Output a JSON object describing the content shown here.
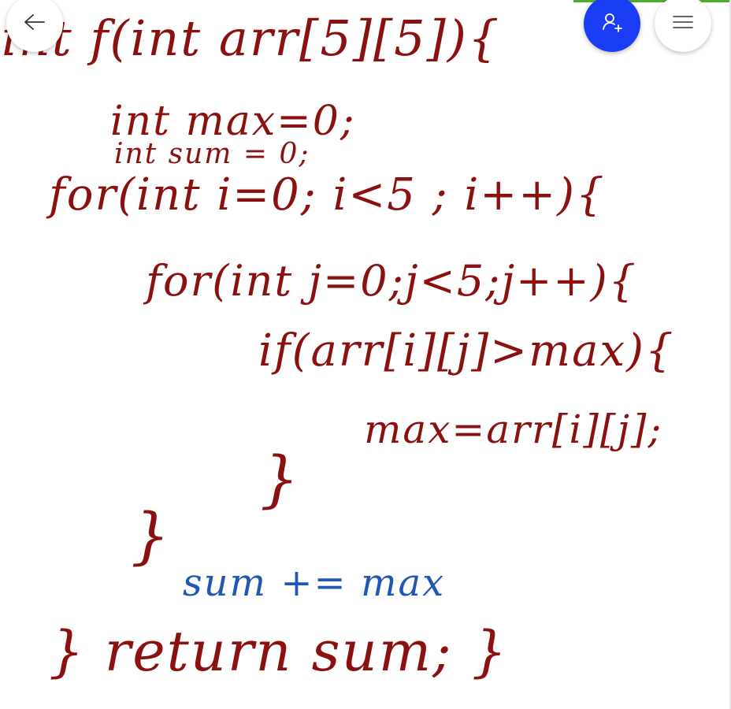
{
  "toolbar": {
    "back_icon": "arrow-left-icon",
    "add_user_icon": "person-add-icon",
    "menu_icon": "hamburger-menu-icon",
    "accent_color": "#4caf2a",
    "add_button_color": "#1a3cf5"
  },
  "canvas": {
    "ink_colors": {
      "primary": "#8b1111",
      "secondary": "#1f57b4"
    },
    "lines": [
      {
        "text": "int f(int arr[5][5]){"
      },
      {
        "text": "int max=0;"
      },
      {
        "text": "int sum = 0;"
      },
      {
        "text": "for(int i=0; i<5 ; i++){"
      },
      {
        "text": "for(int j=0;j<5;j++){"
      },
      {
        "text": "if(arr[i][j]>max){"
      },
      {
        "text": "max=arr[i][j];"
      },
      {
        "text": "}"
      },
      {
        "text": "}"
      },
      {
        "text": "sum += max"
      },
      {
        "text": "} return sum; }"
      }
    ]
  }
}
